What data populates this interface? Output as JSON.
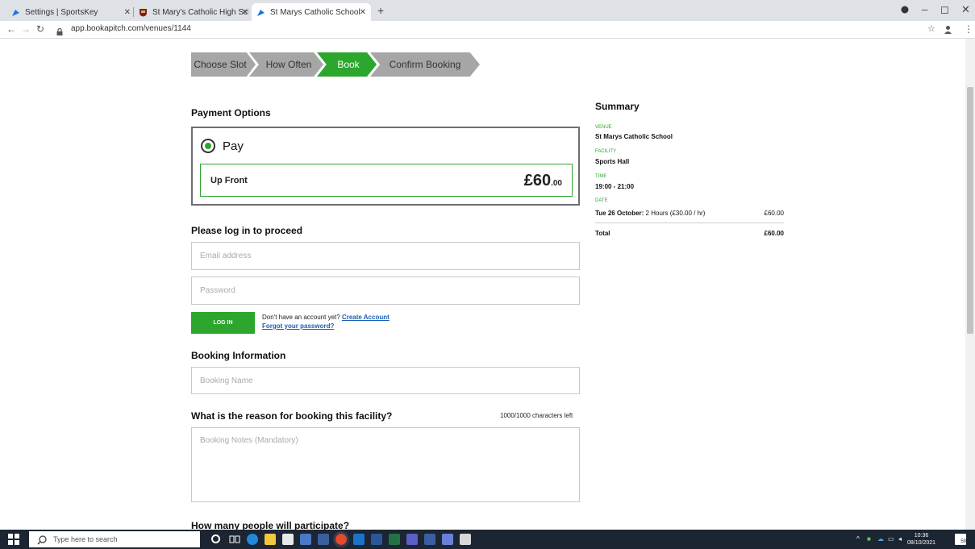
{
  "browser": {
    "tabs": [
      {
        "title": "Settings | SportsKey",
        "active": false
      },
      {
        "title": "St Mary's Catholic High School",
        "active": false
      },
      {
        "title": "St Marys Catholic School | Sports",
        "active": true
      }
    ],
    "new_tab": "+",
    "url": "app.bookapitch.com/venues/1144",
    "controls": {
      "minimize": "–",
      "restore": "◻",
      "close": "✕"
    }
  },
  "steps": [
    {
      "label": "Choose Slot",
      "active": false
    },
    {
      "label": "How Often",
      "active": false
    },
    {
      "label": "Book",
      "active": true
    },
    {
      "label": "Confirm Booking",
      "active": false
    }
  ],
  "payment": {
    "heading": "Payment Options",
    "option_label": "Pay",
    "plan_label": "Up Front",
    "price_main": "£60",
    "price_decimal": ".00"
  },
  "login": {
    "heading": "Please log in to proceed",
    "email_placeholder": "Email address",
    "password_placeholder": "Password",
    "button_label": "LOG IN",
    "no_account_text": "Don't have an account yet?",
    "create_account_link": "Create Account",
    "forgot_password_link": "Forgot your password?"
  },
  "booking": {
    "heading": "Booking Information",
    "name_placeholder": "Booking Name",
    "reason_heading": "What is the reason for booking this facility?",
    "chars_left": "1000/1000 characters left",
    "notes_placeholder": "Booking Notes (Mandatory)",
    "participants_heading": "How many people will participate?"
  },
  "summary": {
    "title": "Summary",
    "venue_label": "VENUE",
    "venue": "St Marys Catholic School",
    "facility_label": "FACILITY",
    "facility": "Sports Hall",
    "time_label": "TIME",
    "time": "19:00 - 21:00",
    "date_label": "DATE",
    "line_date": "Tue 26 October:",
    "line_detail": "2 Hours (£30.00 / hr)",
    "line_amount": "£60.00",
    "total_label": "Total",
    "total_amount": "£60.00"
  },
  "taskbar": {
    "search_placeholder": "Type here to search",
    "time": "10:36",
    "date": "08/10/2021",
    "notification_count": "59"
  },
  "colors": {
    "accent_green": "#2ca62c",
    "step_grey": "#a6a6a6",
    "link_blue": "#1a5fb4",
    "taskbar": "#1c2532"
  }
}
